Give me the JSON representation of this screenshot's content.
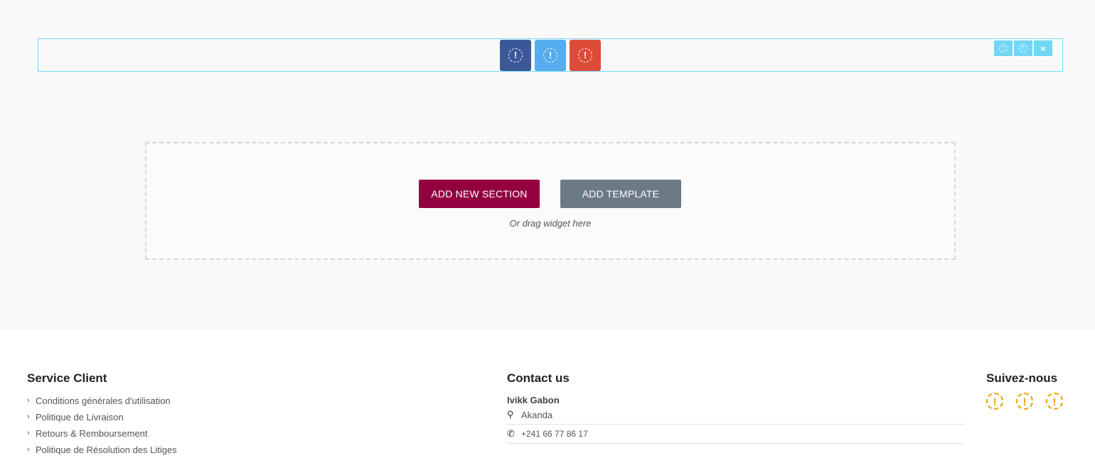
{
  "editor": {
    "share_buttons": [
      {
        "name": "facebook",
        "icon": "alert-circle-icon",
        "color": "#3b5998"
      },
      {
        "name": "twitter",
        "icon": "alert-circle-icon",
        "color": "#55acee"
      },
      {
        "name": "google-plus",
        "icon": "alert-circle-icon",
        "color": "#dd4b39"
      }
    ],
    "row_controls": {
      "icon1": "!",
      "icon2": "!",
      "close": "×"
    },
    "share_glyph": "!",
    "add_section_label": "ADD NEW SECTION",
    "add_template_label": "ADD TEMPLATE",
    "drag_hint": "Or drag widget here",
    "accent_color": "#93003f",
    "border_color": "#71d7f7"
  },
  "footer": {
    "service": {
      "title": "Service Client",
      "items": [
        "Conditions générales d'utilisation",
        "Politique de Livraison",
        "Retours & Remboursement",
        "Politique de Résolution des Litiges"
      ]
    },
    "contact": {
      "title": "Contact us",
      "company": "Ivikk Gabon",
      "location": "Akanda",
      "phone": "+241 66 77 86 17"
    },
    "follow": {
      "title": "Suivez-nous",
      "glyph": "!",
      "social_icon_color": "#f0a100"
    }
  }
}
